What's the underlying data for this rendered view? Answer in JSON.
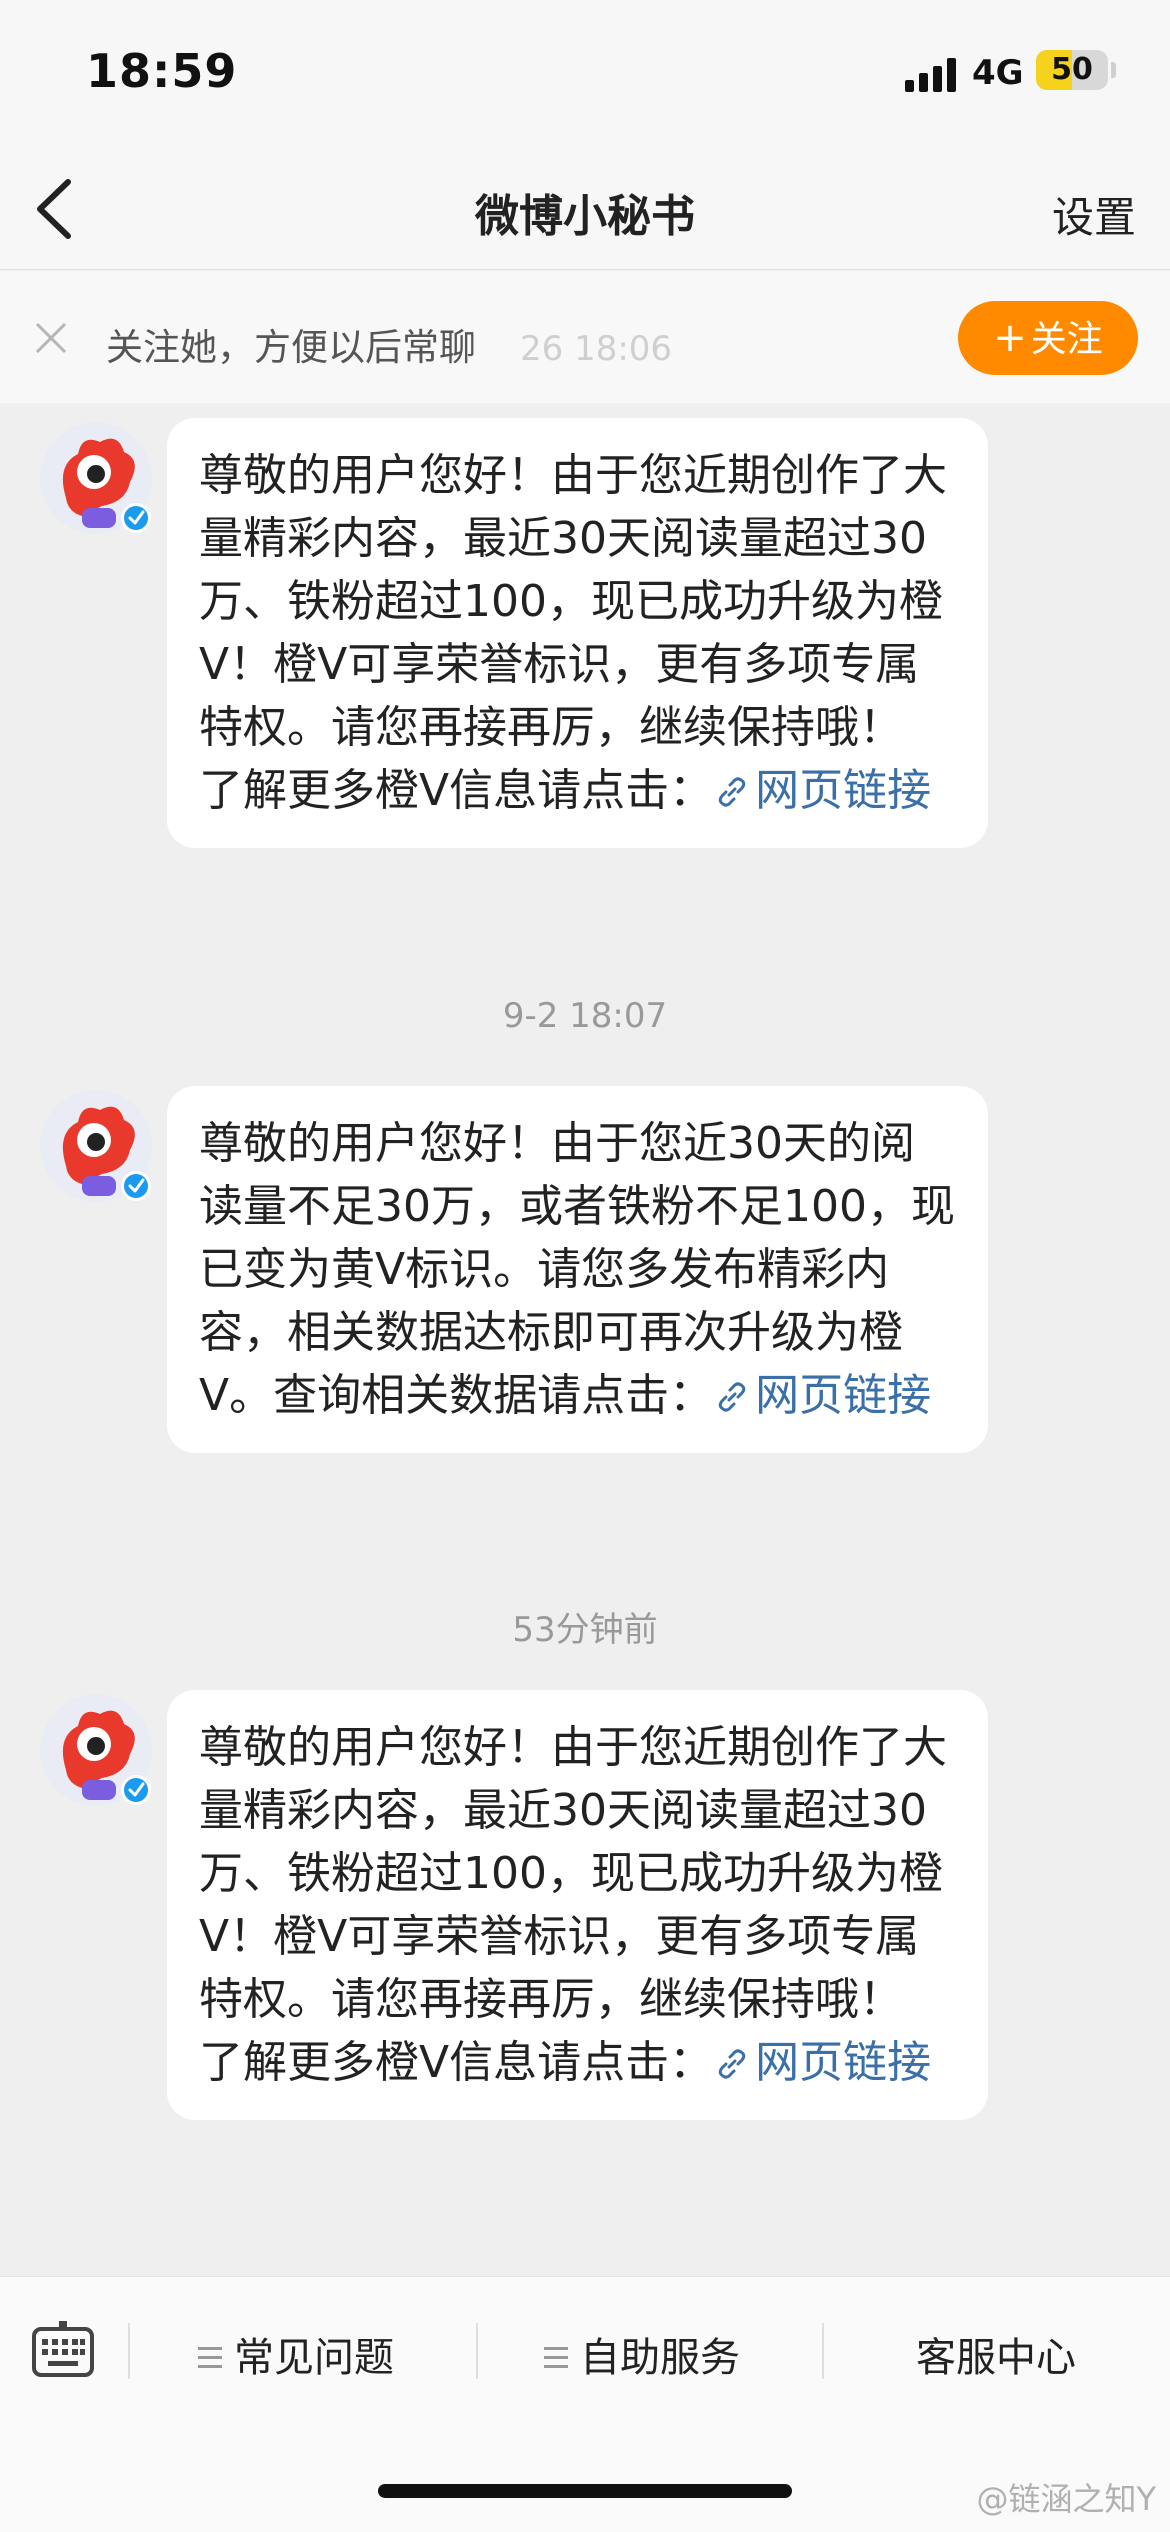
{
  "status_bar": {
    "time": "18:59",
    "network": "4G",
    "battery": "50",
    "battery_level": 0.5
  },
  "nav": {
    "title": "微博小秘书",
    "settings": "设置"
  },
  "banner": {
    "ghost_time": "26 18:06",
    "text": "关注她，方便以后常聊",
    "follow_label": "关注"
  },
  "messages": [
    {
      "text": "尊敬的用户您好！由于您近期创作了大量精彩内容，最近30天阅读量超过30万、铁粉超过100，现已成功升级为橙V！橙V可享荣誉标识，更有多项专属特权。请您再接再厉，继续保持哦！ 了解更多橙V信息请点击：",
      "link": "网页链接"
    },
    {
      "timestamp": "9-2 18:07",
      "text": "尊敬的用户您好！由于您近30天的阅读量不足30万，或者铁粉不足100，现已变为黄V标识。请您多发布精彩内容，相关数据达标即可再次升级为橙V。查询相关数据请点击：",
      "link": "网页链接"
    },
    {
      "timestamp": "53分钟前",
      "text": "尊敬的用户您好！由于您近期创作了大量精彩内容，最近30天阅读量超过30万、铁粉超过100，现已成功升级为橙V！橙V可享荣誉标识，更有多项专属特权。请您再接再厉，继续保持哦！ 了解更多橙V信息请点击：",
      "link": "网页链接"
    }
  ],
  "bottom_bar": {
    "faq": "常见问题",
    "self_service": "自助服务",
    "support": "客服中心"
  },
  "watermark": "@链涵之知Y",
  "colors": {
    "accent": "#ff8a00",
    "link": "#3a6fa8",
    "verified": "#1a9bf0"
  }
}
